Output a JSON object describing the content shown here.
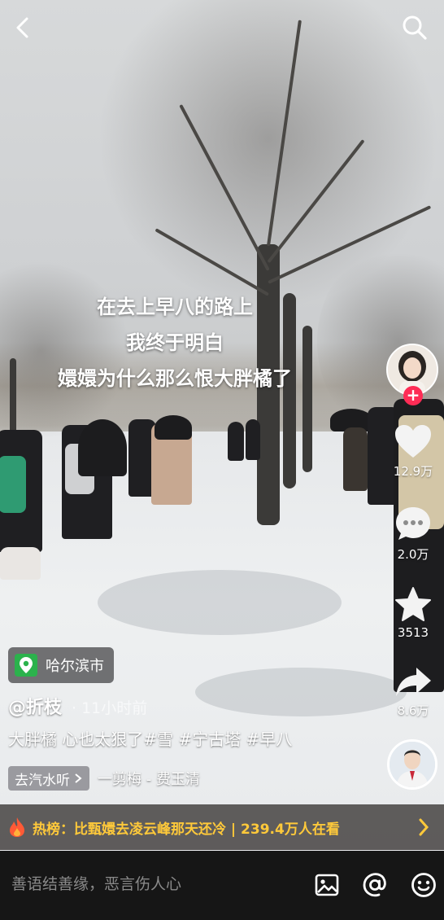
{
  "caption": {
    "lines": [
      "在去上早八的路上",
      "我终于明白",
      "嬛嬛为什么那么恨大胖橘了"
    ]
  },
  "icons": {
    "back": "back-arrow-icon",
    "search": "search-icon",
    "like": "heart-icon",
    "comment": "comment-bubble-icon",
    "favorite": "star-icon",
    "share": "share-arrow-icon",
    "location": "location-pin-icon",
    "hot": "flame-icon",
    "image": "image-icon",
    "mention": "at-icon",
    "emoji": "emoji-icon"
  },
  "rail": {
    "likes": "12.9万",
    "comments": "2.0万",
    "favorites": "3513",
    "shares": "8.6万"
  },
  "info": {
    "location": "哈尔滨市",
    "author": "@折枝",
    "time": "· 11小时前",
    "description": "大胖橘 心也太狠了#雪 #宁古塔 #早八",
    "music_chip": "去汽水听",
    "music_title": "一剪梅 - 费玉清"
  },
  "hot": {
    "text": "热榜：比甄嬛去凌云峰那天还冷 | 239.4万人在看"
  },
  "comment_bar": {
    "placeholder": "善语结善缘，恶言伤人心"
  },
  "colors": {
    "follow_red": "#fe2c55",
    "hot_yellow": "#ffc93a",
    "location_green": "#2bb24c"
  }
}
